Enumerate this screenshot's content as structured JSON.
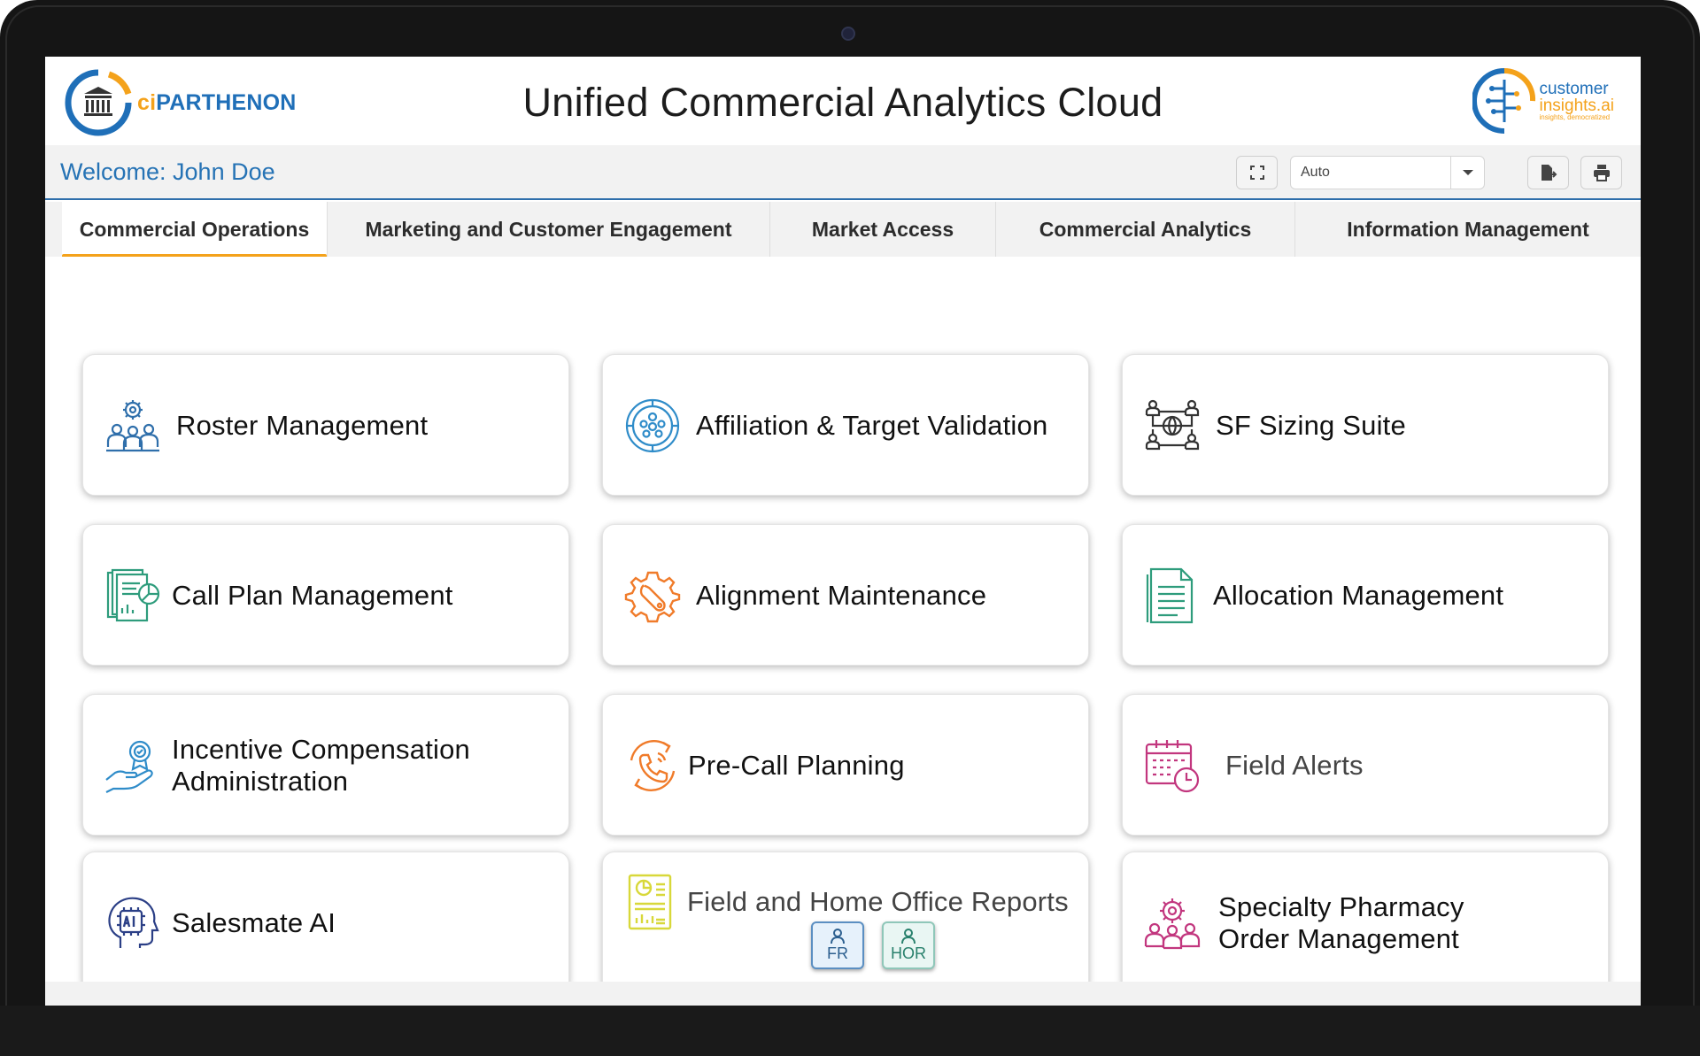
{
  "brand": {
    "left_logo": {
      "prefix": "ci",
      "name": "PARTHENON"
    },
    "right_logo": {
      "line1": "customer",
      "line2": "insights.ai",
      "tagline": "insights, democratized"
    }
  },
  "app_title": "Unified Commercial Analytics Cloud",
  "welcome": "Welcome: John Doe",
  "toolbar": {
    "fullscreen_icon": "expand-icon",
    "select_value": "Auto",
    "export_icon": "export-icon",
    "print_icon": "print-icon"
  },
  "tabs": [
    {
      "label": "Commercial Operations",
      "active": true
    },
    {
      "label": "Marketing and Customer Engagement",
      "active": false
    },
    {
      "label": "Market Access",
      "active": false
    },
    {
      "label": "Commercial Analytics",
      "active": false
    },
    {
      "label": "Information Management",
      "active": false
    }
  ],
  "cards": [
    {
      "label": "Roster Management",
      "icon": "team-gear-icon",
      "color": "#2f6fab"
    },
    {
      "label": "Affiliation & Target Validation",
      "icon": "network-circle-icon",
      "color": "#2f8cc9"
    },
    {
      "label": "SF Sizing Suite",
      "icon": "globe-network-icon",
      "color": "#333333"
    },
    {
      "label": "Call Plan Management",
      "icon": "documents-chart-icon",
      "color": "#2e9c7c"
    },
    {
      "label": "Alignment Maintenance",
      "icon": "wrench-gear-icon",
      "color": "#f07b2a"
    },
    {
      "label": "Allocation Management",
      "icon": "document-list-icon",
      "color": "#2e9c7c"
    },
    {
      "label": "Incentive Compensation Administration",
      "line1": "Incentive Compensation",
      "line2": "Administration",
      "icon": "hand-award-icon",
      "color": "#2f8cc9"
    },
    {
      "label": "Pre-Call Planning",
      "icon": "phone-refresh-icon",
      "color": "#f07b2a"
    },
    {
      "label": "Field Alerts",
      "icon": "calendar-clock-icon",
      "color": "#c2367e"
    },
    {
      "label": "Salesmate AI",
      "icon": "ai-head-icon",
      "color": "#2b3f86"
    },
    {
      "label": "Field and Home Office Reports",
      "icon": "report-chart-icon",
      "color": "#d8d83a",
      "buttons": [
        {
          "label": "FR"
        },
        {
          "label": "HOR"
        }
      ]
    },
    {
      "label": "Specialty Pharmacy Order Management",
      "line1": "Specialty Pharmacy",
      "line2": "Order Management",
      "icon": "people-gear-icon",
      "color": "#c2367e"
    }
  ]
}
